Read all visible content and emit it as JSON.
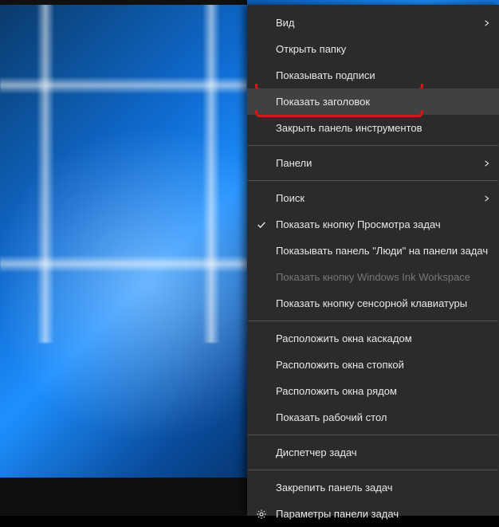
{
  "menu": {
    "items": [
      {
        "label": "Вид",
        "submenu": true
      },
      {
        "label": "Открыть папку"
      },
      {
        "label": "Показывать подписи",
        "annotate": true
      },
      {
        "label": "Показать заголовок",
        "hover": true,
        "annotate": true
      },
      {
        "label": "Закрыть панель инструментов"
      },
      {
        "sep": true
      },
      {
        "label": "Панели",
        "submenu": true
      },
      {
        "sep": true
      },
      {
        "label": "Поиск",
        "submenu": true
      },
      {
        "label": "Показать кнопку Просмотра задач",
        "checked": true
      },
      {
        "label": "Показывать панель \"Люди\" на панели задач"
      },
      {
        "label": "Показать кнопку Windows Ink Workspace",
        "disabled": true
      },
      {
        "label": "Показать кнопку сенсорной клавиатуры"
      },
      {
        "sep": true
      },
      {
        "label": "Расположить окна каскадом"
      },
      {
        "label": "Расположить окна стопкой"
      },
      {
        "label": "Расположить окна рядом"
      },
      {
        "label": "Показать рабочий стол"
      },
      {
        "sep": true
      },
      {
        "label": "Диспетчер задач"
      },
      {
        "sep": true
      },
      {
        "label": "Закрепить панель задач"
      },
      {
        "label": "Параметры панели задач",
        "gear": true
      }
    ]
  }
}
